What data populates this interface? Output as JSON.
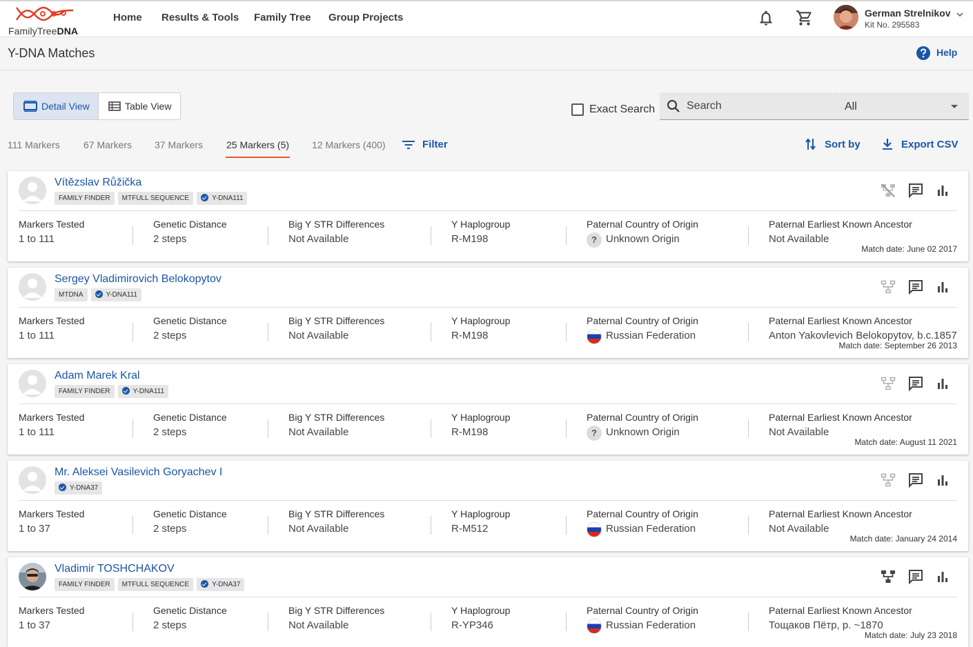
{
  "app": {
    "logo_text_regular": "FamilyTree",
    "logo_text_bold": "DNA",
    "brand_color": "#e03a20",
    "link_color": "#1a56a7"
  },
  "nav": {
    "items": [
      "Home",
      "Results & Tools",
      "Family Tree",
      "Group Projects"
    ]
  },
  "user": {
    "name": "German Strelnikov",
    "kit": "Kit No. 295583",
    "icons": [
      "bell-icon",
      "cart-icon",
      "chevron-down-icon"
    ]
  },
  "page": {
    "title": "Y-DNA Matches",
    "help": "Help"
  },
  "view_toggle": {
    "detail": "Detail View",
    "table": "Table View",
    "selected": "Detail View"
  },
  "search": {
    "exact_label": "Exact Search",
    "exact_checked": false,
    "placeholder": "Search",
    "scope": "All"
  },
  "marker_tabs": [
    "111 Markers",
    "67 Markers",
    "37 Markers",
    "25 Markers (5)",
    "12 Markers (400)"
  ],
  "active_marker_tab": "25 Markers (5)",
  "actions": {
    "filter": "Filter",
    "sort": "Sort by",
    "export": "Export CSV"
  },
  "field_labels": {
    "markers": "Markers Tested",
    "distance": "Genetic Distance",
    "bigy": "Big Y STR Differences",
    "haplo": "Y Haplogroup",
    "country": "Paternal Country of Origin",
    "ancestor": "Paternal Earliest Known Ancestor"
  },
  "matches": [
    {
      "name": "Vítězslav Růžička",
      "tags": [
        {
          "label": "FAMILY FINDER",
          "verified": false
        },
        {
          "label": "MTFULL SEQUENCE",
          "verified": false
        },
        {
          "label": "Y-DNA111",
          "verified": true
        }
      ],
      "markers": "1 to 111",
      "distance": "2 steps",
      "bigy": "Not Available",
      "haplo": "R-M198",
      "country": "Unknown Origin",
      "country_icon": "unknown-origin-icon",
      "ancestor": "Not Available",
      "match_date": "Match date: June 02 2017",
      "tree_state": "no-tree"
    },
    {
      "name": "Sergey Vladimirovich Belokopytov",
      "tags": [
        {
          "label": "MTDNA",
          "verified": false
        },
        {
          "label": "Y-DNA111",
          "verified": true
        }
      ],
      "markers": "1 to 111",
      "distance": "2 steps",
      "bigy": "Not Available",
      "haplo": "R-M198",
      "country": "Russian Federation",
      "country_icon": "russia-flag-icon",
      "ancestor": "Anton Yakovlevich Belokopytov, b.c.1857",
      "match_date": "Match date: September 26 2013",
      "tree_state": "light"
    },
    {
      "name": "Adam Marek Kral",
      "tags": [
        {
          "label": "FAMILY FINDER",
          "verified": false
        },
        {
          "label": "Y-DNA111",
          "verified": true
        }
      ],
      "markers": "1 to 111",
      "distance": "2 steps",
      "bigy": "Not Available",
      "haplo": "R-M198",
      "country": "Unknown Origin",
      "country_icon": "unknown-origin-icon",
      "ancestor": "Not Available",
      "match_date": "Match date: August 11 2021",
      "tree_state": "light"
    },
    {
      "name": "Mr. Aleksei Vasilevich Goryachev I",
      "tags": [
        {
          "label": "Y-DNA37",
          "verified": true
        }
      ],
      "markers": "1 to 37",
      "distance": "2 steps",
      "bigy": "Not Available",
      "haplo": "R-M512",
      "country": "Russian Federation",
      "country_icon": "russia-flag-icon",
      "ancestor": "Not Available",
      "match_date": "Match date: January 24 2014",
      "tree_state": "light"
    },
    {
      "name": "Vladimir TOSHCHAKOV",
      "tags": [
        {
          "label": "FAMILY FINDER",
          "verified": false
        },
        {
          "label": "MTFULL SEQUENCE",
          "verified": false
        },
        {
          "label": "Y-DNA37",
          "verified": true
        }
      ],
      "markers": "1 to 37",
      "distance": "2 steps",
      "bigy": "Not Available",
      "haplo": "R-YP346",
      "country": "Russian Federation",
      "country_icon": "russia-flag-icon",
      "ancestor": "Тощаков Пётр, р. ~1870",
      "match_date": "Match date: July 23 2018",
      "tree_state": "dark",
      "has_photo": true
    }
  ]
}
